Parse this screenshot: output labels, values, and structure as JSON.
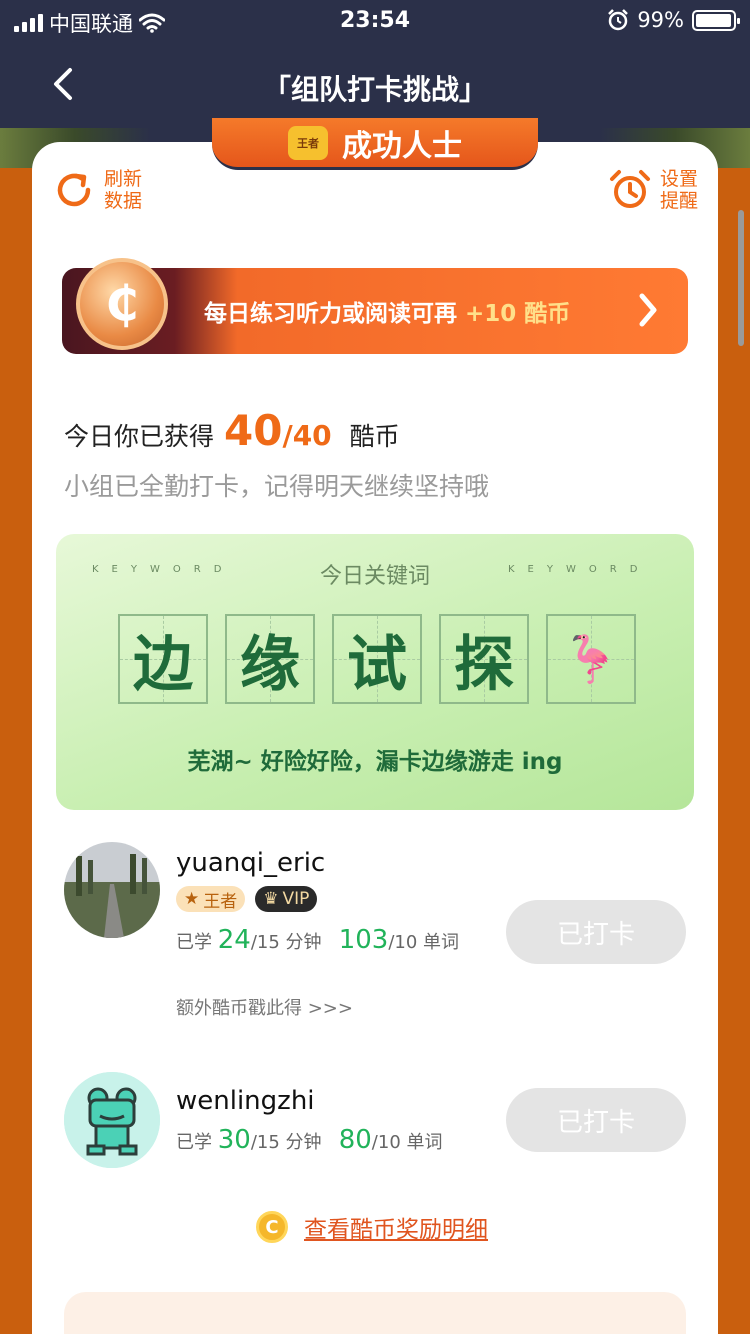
{
  "status_bar": {
    "carrier": "中国联通",
    "time": "23:54",
    "battery": "99%"
  },
  "nav": {
    "title": "「组队打卡挑战」"
  },
  "achievement": {
    "medal": "王者",
    "label": "成功人士"
  },
  "refresh": {
    "line1": "刷新",
    "line2": "数据"
  },
  "reminder": {
    "line1": "设置",
    "line2": "提醒"
  },
  "coin_banner": {
    "text": "每日练习听力或阅读可再 ",
    "reward": "+10 酷币"
  },
  "today": {
    "prefix": "今日你已获得",
    "earned": "40",
    "total": "/40",
    "unit": "酷币",
    "subtitle": "小组已全勤打卡，记得明天继续坚持哦"
  },
  "keyword": {
    "en_left": "KEYWORD",
    "en_right": "KEYWORD",
    "title": "今日关键词",
    "chars": [
      "边",
      "缘",
      "试",
      "探",
      "🦩"
    ],
    "caption": "芜湖~ 好险好险，漏卡边缘游走 ing"
  },
  "members": [
    {
      "name": "yuanqi_eric",
      "badge_king": "王者",
      "badge_vip": "VIP",
      "stat_prefix": "已学 ",
      "minutes": "24",
      "minutes_target": "/15 分钟",
      "words": "103",
      "words_target": "/10 单词",
      "extra": "额外酷币戳此得 >>>",
      "button": "已打卡"
    },
    {
      "name": "wenlingzhi",
      "stat_prefix": "已学 ",
      "minutes": "30",
      "minutes_target": "/15 分钟",
      "words": "80",
      "words_target": "/10 单词",
      "button": "已打卡"
    }
  ],
  "detail_link": {
    "coin": "C",
    "text": "查看酷币奖励明细"
  },
  "colors": {
    "nav": "#2b3049",
    "accent": "#ef6a17",
    "green": "#21b35a",
    "bg": "#c95f0e"
  }
}
